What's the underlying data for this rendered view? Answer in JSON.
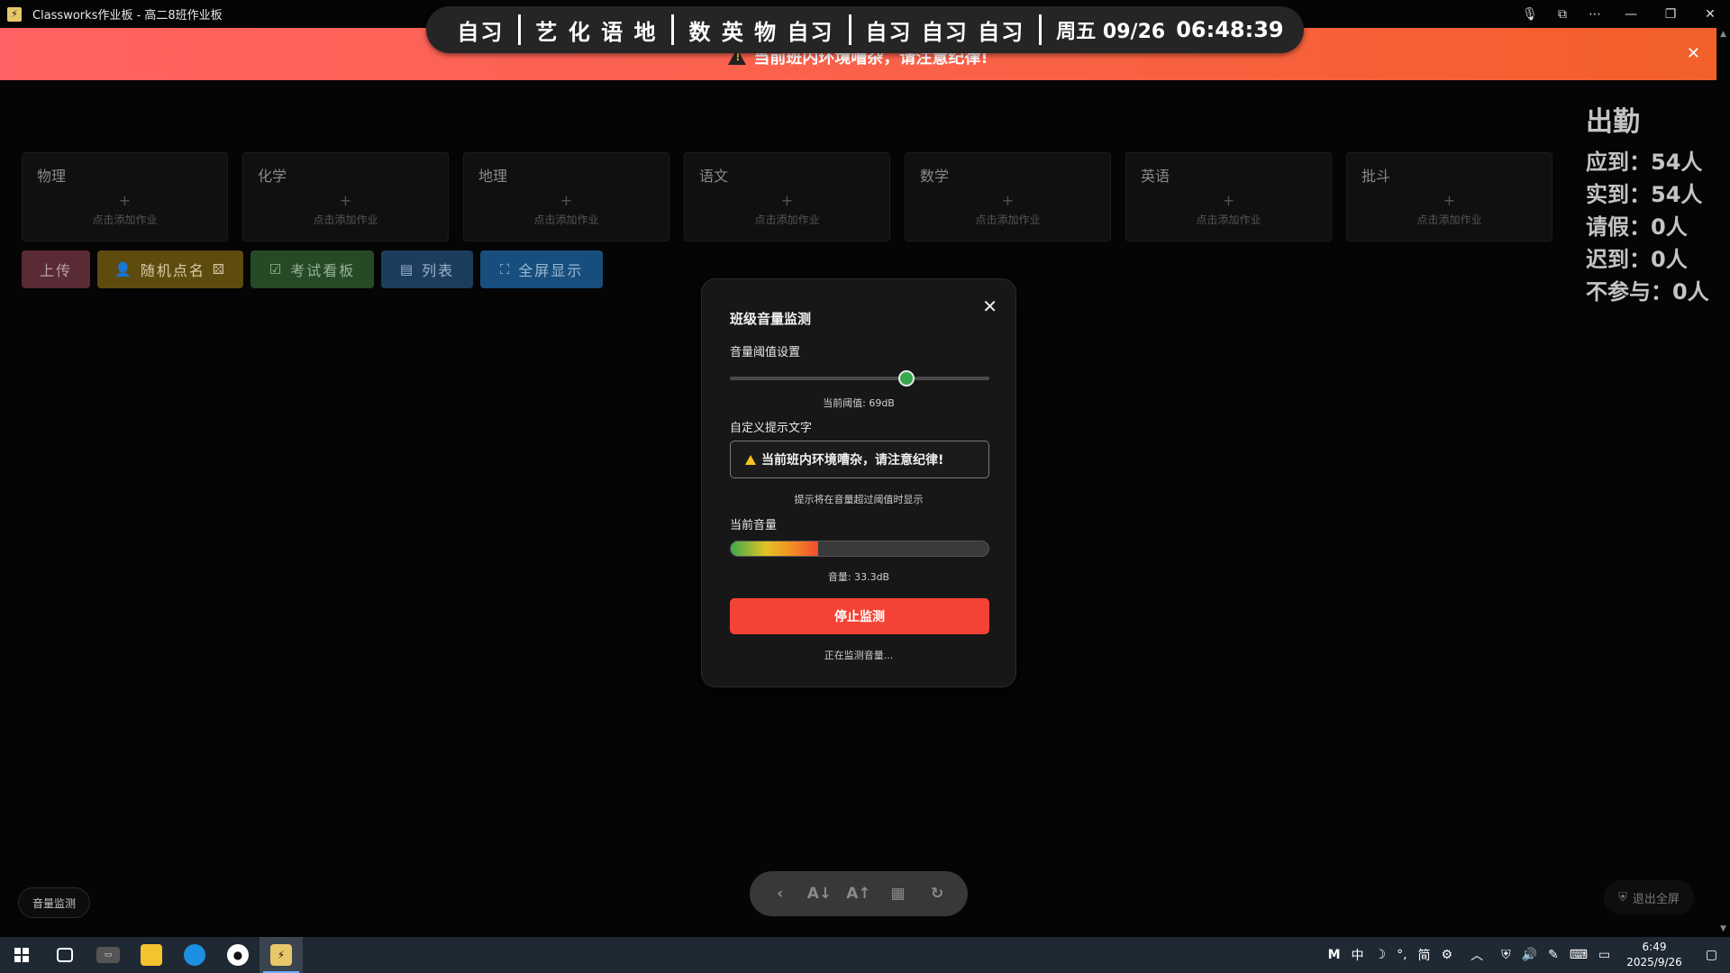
{
  "window": {
    "title": "Classworks作业板 - 高二8班作业板"
  },
  "schedule": {
    "items": [
      "自习",
      "艺 化 语 地",
      "数 英 物 自习",
      "自习 自习 自习"
    ],
    "date": "周五 09/26",
    "time": "06:48:39"
  },
  "alert": {
    "text": "当前班内环境嘈杂，请注意纪律!",
    "close": "✕"
  },
  "subjects": [
    {
      "name": "物理",
      "hint": "点击添加作业"
    },
    {
      "name": "化学",
      "hint": "点击添加作业"
    },
    {
      "name": "地理",
      "hint": "点击添加作业"
    },
    {
      "name": "语文",
      "hint": "点击添加作业"
    },
    {
      "name": "数学",
      "hint": "点击添加作业"
    },
    {
      "name": "英语",
      "hint": "点击添加作业"
    },
    {
      "name": "批斗",
      "hint": "点击添加作业"
    }
  ],
  "actions": {
    "upload": "上传",
    "random_call": "随机点名",
    "exam_board": "考试看板",
    "list": "列表",
    "fullscreen": "全屏显示"
  },
  "attendance": {
    "title": "出勤",
    "expected": "应到：54人",
    "actual": "实到：54人",
    "leave": "请假：0人",
    "late": "迟到：0人",
    "absent": "不参与：0人"
  },
  "modal": {
    "title": "班级音量监测",
    "threshold_label": "音量阈值设置",
    "threshold_fraction": 0.68,
    "threshold_text": "当前阈值: 69dB",
    "custom_text_label": "自定义提示文字",
    "custom_text_value": "当前班内环境嘈杂，请注意纪律!",
    "custom_text_hint": "提示将在音量超过阈值时显示",
    "current_volume_label": "当前音量",
    "volume_fraction": 0.34,
    "volume_text": "音量: 33.3dB",
    "stop_button": "停止监测",
    "status": "正在监测音量..."
  },
  "bottom": {
    "volume_monitor": "音量监测",
    "exit_fullscreen": "退出全屏"
  },
  "taskbar": {
    "ime_mode": "M",
    "ime_lang": "中",
    "ime_simplified": "简",
    "clock_time": "6:49",
    "clock_date": "2025/9/26"
  },
  "colors": {
    "alert_start": "#ff6363",
    "alert_end": "#f2602a",
    "stop_button": "#f44336",
    "slider_knob": "#37a84c"
  }
}
